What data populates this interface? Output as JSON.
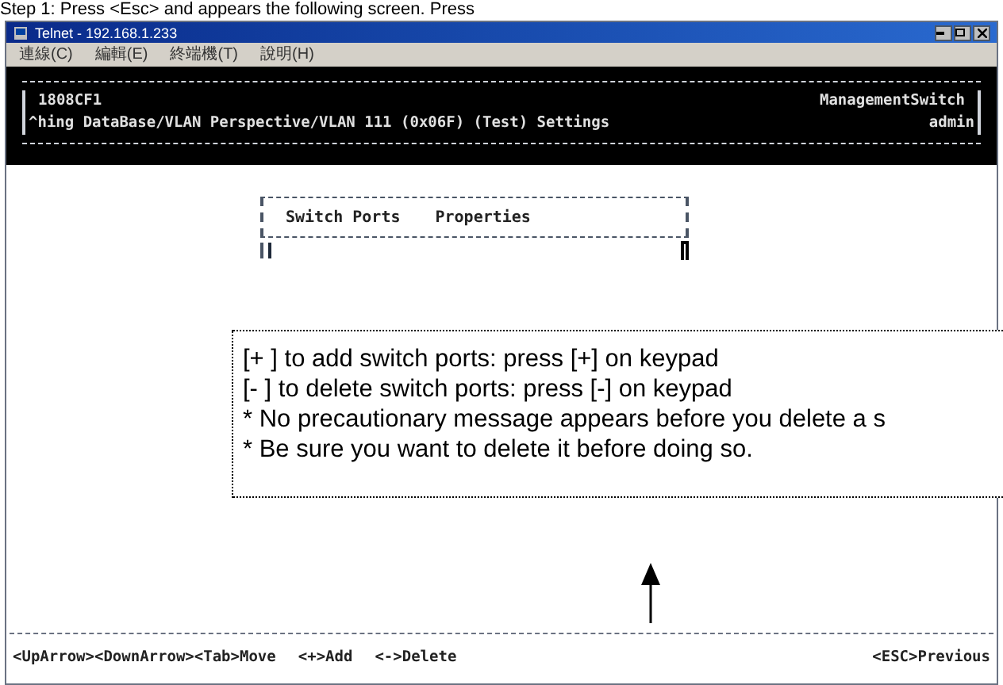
{
  "caption": "Step 1:    Press <Esc> and appears the following screen. Press",
  "window": {
    "title": "Telnet - 192.168.1.233"
  },
  "menu": [
    "連線(C)",
    "編輯(E)",
    "終端機(T)",
    "說明(H)"
  ],
  "header": {
    "device": "1808CF1",
    "path": "^hing DataBase/VLAN Perspective/VLAN 111 (0x06F) (Test) Settings",
    "product": "ManagementSwitch",
    "user": "admin"
  },
  "table": {
    "columns": [
      "Switch Ports",
      "Properties"
    ]
  },
  "callout": [
    "[+ ] to add switch ports: press [+] on keypad",
    "[-  ] to delete switch ports: press [-] on keypad",
    "* No precautionary message appears before you delete a s",
    "* Be sure you want to delete it before doing so."
  ],
  "keys": [
    "<UpArrow><DownArrow><Tab>Move",
    "<+>Add",
    "<->Delete",
    "<ESC>Previous"
  ]
}
